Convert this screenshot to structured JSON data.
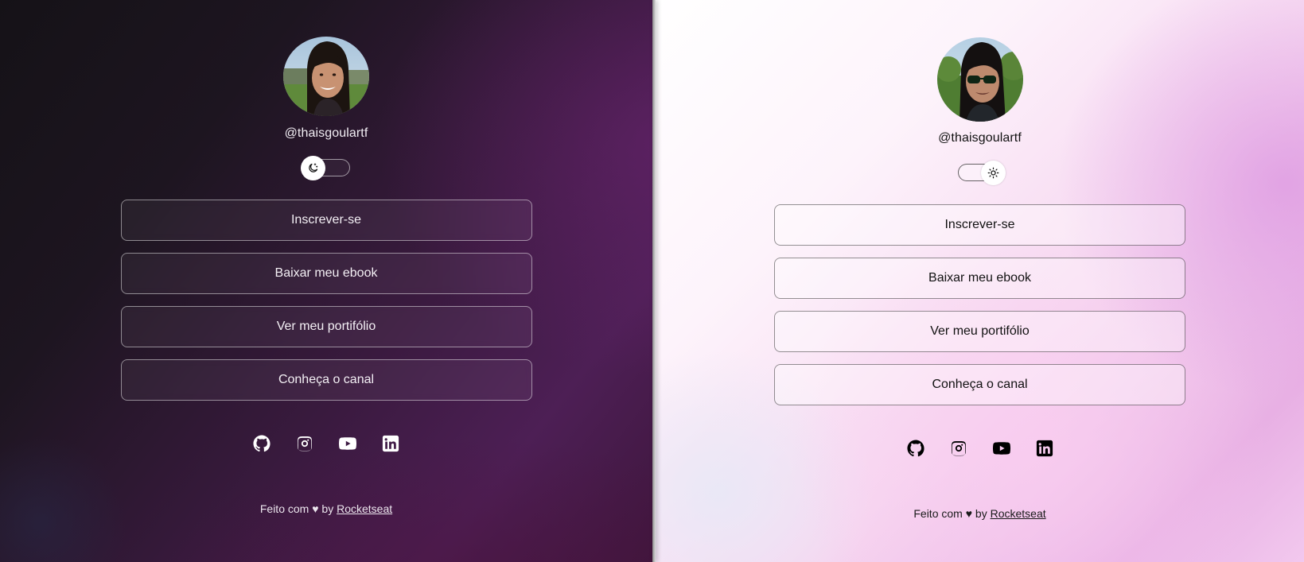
{
  "profile": {
    "handle": "@thaisgoulartf"
  },
  "links": [
    {
      "label": "Inscrever-se"
    },
    {
      "label": "Baixar meu ebook"
    },
    {
      "label": "Ver meu portifólio"
    },
    {
      "label": "Conheça o canal"
    }
  ],
  "socials": [
    {
      "icon": "github-icon"
    },
    {
      "icon": "instagram-icon"
    },
    {
      "icon": "youtube-icon"
    },
    {
      "icon": "linkedin-icon"
    }
  ],
  "footer": {
    "prefix": "Feito com ♥ by ",
    "brand": "Rocketseat"
  },
  "themes": {
    "dark": {
      "toggle_icon": "moon-icon",
      "text_color": "#ffffff"
    },
    "light": {
      "toggle_icon": "sun-icon",
      "text_color": "#000000"
    }
  }
}
